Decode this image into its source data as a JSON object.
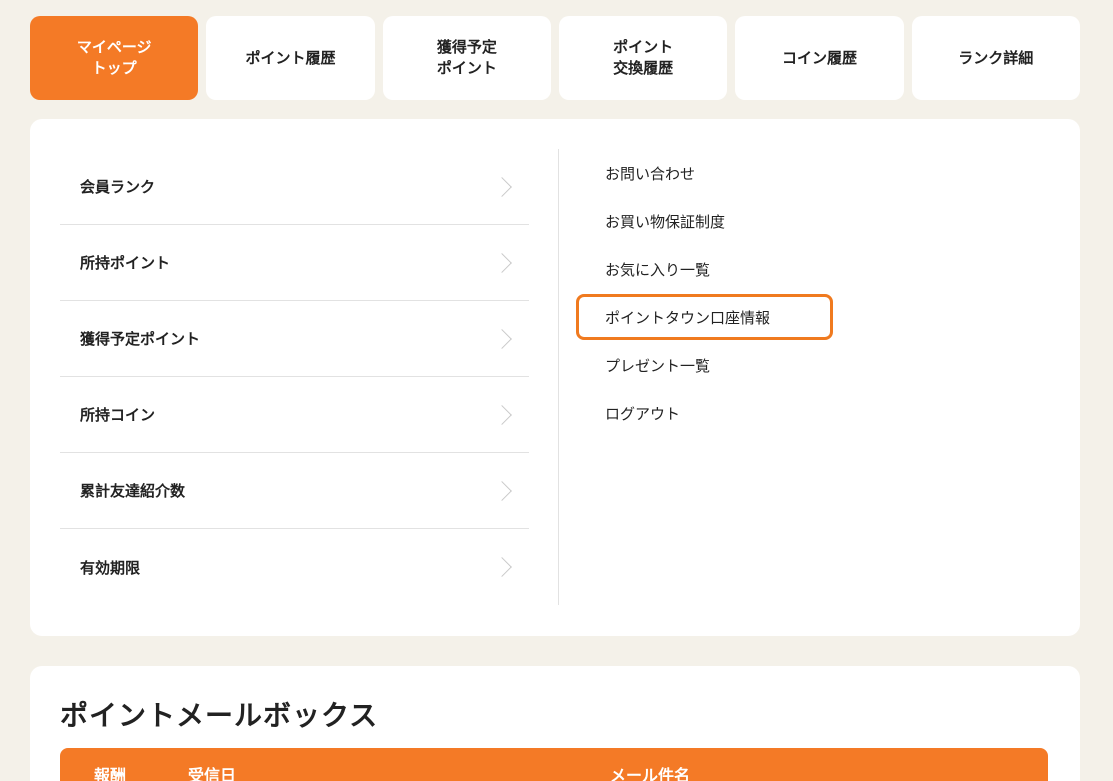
{
  "tabs": [
    {
      "label": "マイページ\nトップ",
      "active": true
    },
    {
      "label": "ポイント履歴"
    },
    {
      "label": "獲得予定\nポイント"
    },
    {
      "label": "ポイント\n交換履歴"
    },
    {
      "label": "コイン履歴"
    },
    {
      "label": "ランク詳細"
    }
  ],
  "menu": {
    "left_items": [
      {
        "label": "会員ランク"
      },
      {
        "label": "所持ポイント"
      },
      {
        "label": "獲得予定ポイント"
      },
      {
        "label": "所持コイン"
      },
      {
        "label": "累計友達紹介数"
      },
      {
        "label": "有効期限"
      }
    ],
    "right_items": [
      {
        "label": "お問い合わせ"
      },
      {
        "label": "お買い物保証制度"
      },
      {
        "label": "お気に入り一覧"
      },
      {
        "label": "ポイントタウン口座情報"
      },
      {
        "label": "プレゼント一覧"
      },
      {
        "label": "ログアウト"
      }
    ]
  },
  "mailbox": {
    "title": "ポイントメールボックス",
    "columns": {
      "reward": "報酬",
      "date": "受信日",
      "subject": "メール件名"
    }
  },
  "colors": {
    "accent": "#f47a26",
    "highlight_border": "#f07a1f",
    "background": "#f4f1e9"
  }
}
